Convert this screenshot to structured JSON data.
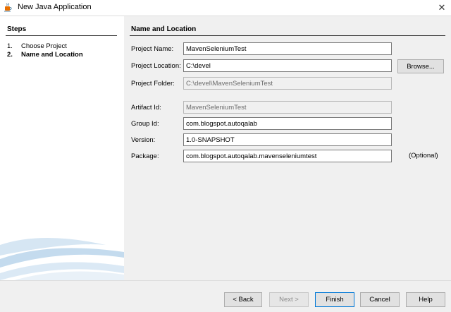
{
  "window": {
    "title": "New Java Application",
    "app_icon": "java-cup-icon",
    "close_icon": "close-icon",
    "close_glyph": "✕"
  },
  "steps": {
    "title": "Steps",
    "items": [
      {
        "num": "1.",
        "label": "Choose Project"
      },
      {
        "num": "2.",
        "label": "Name and Location"
      }
    ]
  },
  "form": {
    "section_title": "Name and Location",
    "project_name": {
      "label": "Project Name:",
      "value": "MavenSeleniumTest"
    },
    "project_location": {
      "label": "Project Location:",
      "value": "C:\\devel"
    },
    "browse_label": "Browse...",
    "project_folder": {
      "label": "Project Folder:",
      "value": "C:\\devel\\MavenSeleniumTest"
    },
    "artifact_id": {
      "label": "Artifact Id:",
      "value": "MavenSeleniumTest"
    },
    "group_id": {
      "label": "Group Id:",
      "value": "com.blogspot.autoqalab"
    },
    "version": {
      "label": "Version:",
      "value": "1.0-SNAPSHOT"
    },
    "package": {
      "label": "Package:",
      "value": "com.blogspot.autoqalab.mavenseleniumtest"
    },
    "optional_label": "(Optional)"
  },
  "buttons": {
    "back": "< Back",
    "next": "Next >",
    "finish": "Finish",
    "cancel": "Cancel",
    "help": "Help"
  },
  "colors": {
    "accent": "#0078d7",
    "panel_bg": "#f0f0f0",
    "steps_bg": "#ffffff"
  }
}
